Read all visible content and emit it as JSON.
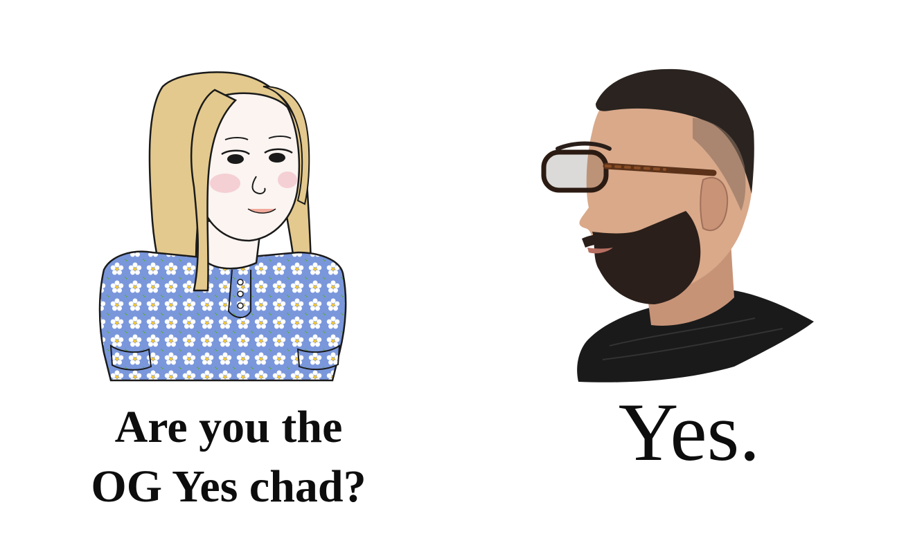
{
  "meme": {
    "left_panel": {
      "figure": "wojak-girl-in-floral-dress",
      "caption_lines": [
        "Are you the",
        "OG Yes chad?"
      ]
    },
    "right_panel": {
      "figure": "bearded-man-with-glasses-profile",
      "caption": "Yes."
    },
    "colors": {
      "background": "#ffffff",
      "text": "#0d0d0d",
      "hair_blonde": "#e3c98d",
      "dress_blue": "#6f8fd8",
      "skin_light": "#fbf4f1",
      "skin_tan": "#d9a98a",
      "beard": "#2a1f1a",
      "shirt_black": "#1a1a1a"
    }
  }
}
